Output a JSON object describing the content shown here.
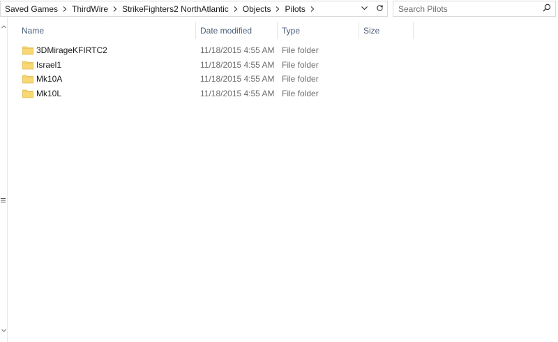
{
  "address_bar": {
    "breadcrumbs": [
      "Saved Games",
      "ThirdWire",
      "StrikeFighters2 NorthAtlantic",
      "Objects",
      "Pilots"
    ],
    "dropdown_icon": "chevron-down-icon",
    "refresh_icon": "refresh-icon"
  },
  "search": {
    "placeholder": "Search Pilots",
    "value": "",
    "icon": "search-icon"
  },
  "columns": {
    "name": "Name",
    "date_modified": "Date modified",
    "type": "Type",
    "size": "Size"
  },
  "files": [
    {
      "name": "3DMirageKFIRTC2",
      "date_modified": "11/18/2015 4:55 AM",
      "type": "File folder",
      "size": ""
    },
    {
      "name": "Israel1",
      "date_modified": "11/18/2015 4:55 AM",
      "type": "File folder",
      "size": ""
    },
    {
      "name": "Mk10A",
      "date_modified": "11/18/2015 4:55 AM",
      "type": "File folder",
      "size": ""
    },
    {
      "name": "Mk10L",
      "date_modified": "11/18/2015 4:55 AM",
      "type": "File folder",
      "size": ""
    }
  ],
  "colors": {
    "folder": "#f8d775",
    "folder_dark": "#e0b84a",
    "header_text": "#4c607a",
    "muted_text": "#6d6d6d"
  }
}
